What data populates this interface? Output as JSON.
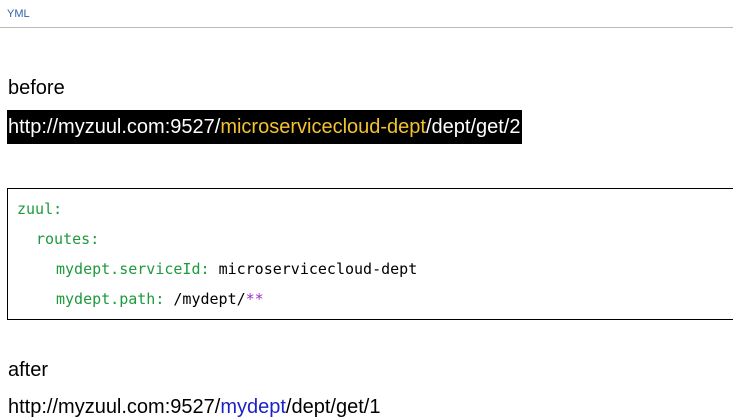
{
  "code_label": "YML",
  "before": {
    "heading": "before",
    "url_prefix": "http://myzuul.com:9527/",
    "url_highlight": "microservicecloud-dept",
    "url_suffix": "/dept/get/2",
    "highlight_color": "#f3c230"
  },
  "code": {
    "zuul": "zuul",
    "routes": "routes",
    "service_key": "mydept.serviceId",
    "service_value": "microservicecloud-dept",
    "path_key": "mydept.path",
    "path_value": "/mydept/",
    "path_wildcard": "**",
    "colon": ":",
    "key_color": "#1d9a3c",
    "wildcard_color": "#9b2fc9"
  },
  "after": {
    "heading": "after",
    "url_prefix": "http://myzuul.com:9527/",
    "url_highlight": "mydept",
    "url_suffix": "/dept/get/1",
    "highlight_color": "#1d22c6"
  }
}
